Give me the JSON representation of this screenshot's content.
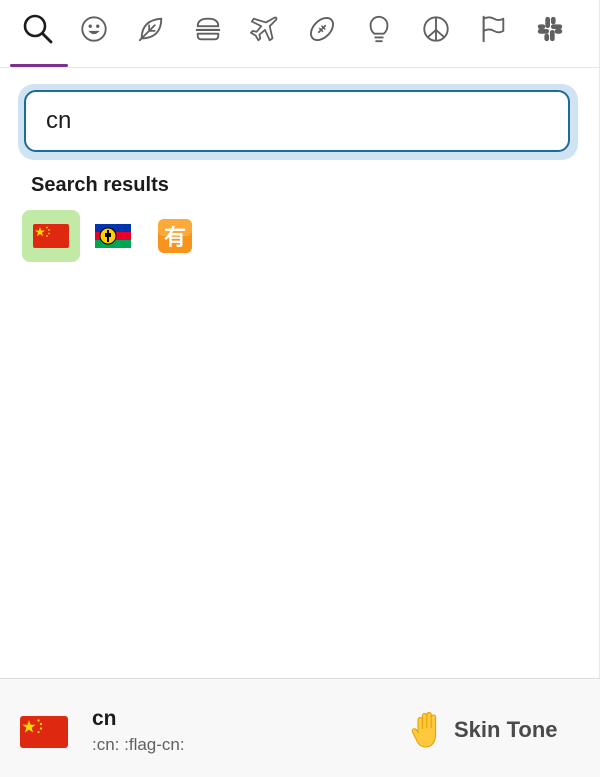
{
  "tabs": [
    {
      "icon": "search-icon"
    },
    {
      "icon": "smiley-icon"
    },
    {
      "icon": "leaf-icon"
    },
    {
      "icon": "burger-icon"
    },
    {
      "icon": "airplane-icon"
    },
    {
      "icon": "football-icon"
    },
    {
      "icon": "lightbulb-icon"
    },
    {
      "icon": "peace-icon"
    },
    {
      "icon": "flag-icon"
    },
    {
      "icon": "slack-icon"
    }
  ],
  "search": {
    "value": "cn",
    "placeholder": ""
  },
  "results": {
    "title": "Search results",
    "items": [
      {
        "icon": "china-flag-icon",
        "selected": true
      },
      {
        "icon": "new-caledonia-flag-icon",
        "selected": false
      },
      {
        "icon": "have-kanji-icon",
        "selected": false
      }
    ]
  },
  "footer": {
    "preview_name": "cn",
    "preview_codes": ":cn: :flag-cn:",
    "skin_tone_label": "Skin Tone",
    "skin_tone_icon": "raised-hand-icon"
  },
  "colors": {
    "accent_underline": "#7b2f8e",
    "search_border": "#1e6b95",
    "search_glow": "#cfe3f2",
    "selected_bg": "#c3e9a6",
    "footer_bg": "#f8f8f8"
  }
}
